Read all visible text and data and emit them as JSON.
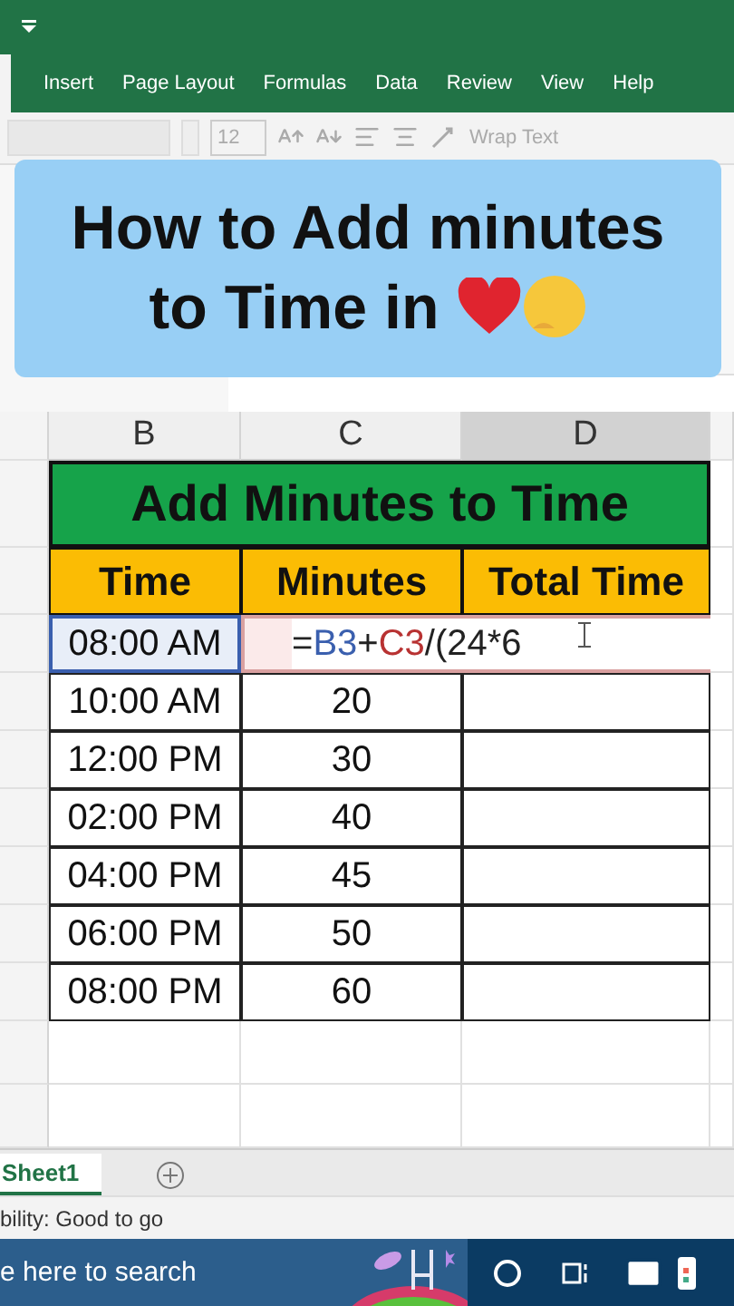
{
  "ribbon": {
    "tabs": [
      {
        "label": "Insert",
        "selected": false
      },
      {
        "label": "Page Layout",
        "selected": false
      },
      {
        "label": "Formulas",
        "selected": false
      },
      {
        "label": "Data",
        "selected": false
      },
      {
        "label": "Review",
        "selected": false
      },
      {
        "label": "View",
        "selected": false
      },
      {
        "label": "Help",
        "selected": false
      }
    ]
  },
  "toolbar": {
    "font_size": "12",
    "wrap_text": "Wrap Text"
  },
  "overlay": {
    "title": "How to Add minutes to Time in"
  },
  "sheet": {
    "columns": [
      {
        "label": "B",
        "selected": false
      },
      {
        "label": "C",
        "selected": false
      },
      {
        "label": "D",
        "selected": true
      }
    ],
    "title": "Add Minutes to Time",
    "headers": [
      "Time",
      "Minutes",
      "Total Time"
    ],
    "editing_row": {
      "time": "08:00 AM",
      "formula": [
        {
          "text": "="
        },
        {
          "text": "B3",
          "color": "#3a5fae"
        },
        {
          "text": "+"
        },
        {
          "text": "C3",
          "color": "#b83232"
        },
        {
          "text": "/(24*6"
        }
      ]
    },
    "rows": [
      {
        "time": "10:00 AM",
        "minutes": "20"
      },
      {
        "time": "12:00 PM",
        "minutes": "30"
      },
      {
        "time": "02:00 PM",
        "minutes": "40"
      },
      {
        "time": "04:00 PM",
        "minutes": "45"
      },
      {
        "time": "06:00 PM",
        "minutes": "50"
      },
      {
        "time": "08:00 PM",
        "minutes": "60"
      }
    ]
  },
  "sheet_tabs": [
    {
      "label": "Sheet1",
      "selected": true
    }
  ],
  "status_bar": {
    "text": "bility: Good to go"
  },
  "taskbar": {
    "search_placeholder": "e here to search"
  }
}
